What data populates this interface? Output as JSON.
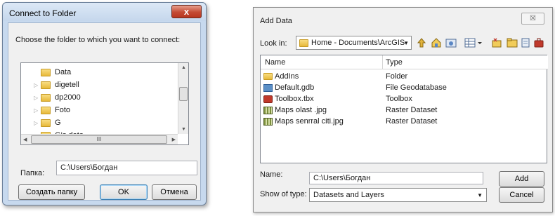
{
  "connect_dialog": {
    "title": "Connect to Folder",
    "close_symbol": "x",
    "prompt": "Choose the folder to which you want to connect:",
    "tree_items": [
      {
        "label": "Data",
        "expandable": false
      },
      {
        "label": "digetell",
        "expandable": true
      },
      {
        "label": "dp2000",
        "expandable": true
      },
      {
        "label": "Foto",
        "expandable": true
      },
      {
        "label": "G",
        "expandable": true
      },
      {
        "label": "Gis data",
        "expandable": true
      }
    ],
    "hscroll_grip": "III",
    "path_label": "Папка:",
    "path_value": "C:\\Users\\Богдан",
    "buttons": {
      "create_folder": "Создать папку",
      "ok": "OK",
      "cancel": "Отмена"
    }
  },
  "add_data_dialog": {
    "title": "Add Data",
    "close_symbol": "☒",
    "look_in_label": "Look in:",
    "look_in_value": "Home - Documents\\ArcGIS",
    "columns": {
      "name": "Name",
      "type": "Type"
    },
    "rows": [
      {
        "name": "AddIns",
        "type": "Folder",
        "icon": "folder-icon"
      },
      {
        "name": "Default.gdb",
        "type": "File Geodatabase",
        "icon": "geodatabase-icon"
      },
      {
        "name": "Toolbox.tbx",
        "type": "Toolbox",
        "icon": "toolbox-icon"
      },
      {
        "name": "Maps olast .jpg",
        "type": "Raster Dataset",
        "icon": "raster-icon"
      },
      {
        "name": "Maps senrral citi.jpg",
        "type": "Raster Dataset",
        "icon": "raster-icon"
      }
    ],
    "name_label": "Name:",
    "name_value": "C:\\Users\\Богдан",
    "show_type_label": "Show of type:",
    "show_type_value": "Datasets and Layers",
    "buttons": {
      "add": "Add",
      "cancel": "Cancel"
    }
  },
  "colors": {
    "win7_frame": "#c7d9ee",
    "close_red": "#c44a33",
    "folder_yellow": "#e7b93a",
    "default_button_border": "#3c7fb1"
  }
}
